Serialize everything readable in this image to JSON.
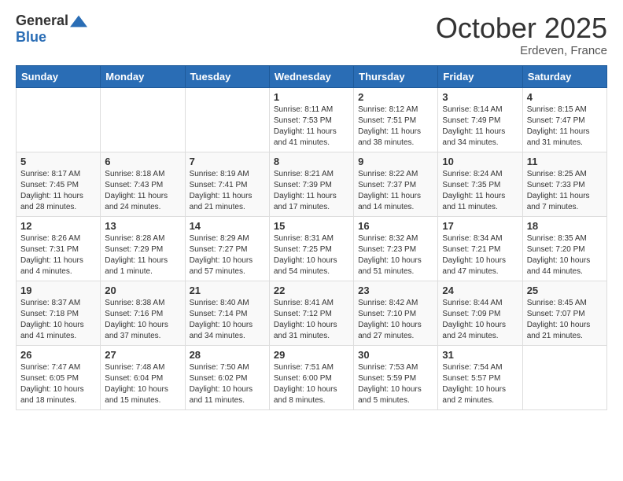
{
  "header": {
    "logo_general": "General",
    "logo_blue": "Blue",
    "month_title": "October 2025",
    "location": "Erdeven, France"
  },
  "weekdays": [
    "Sunday",
    "Monday",
    "Tuesday",
    "Wednesday",
    "Thursday",
    "Friday",
    "Saturday"
  ],
  "weeks": [
    [
      {
        "day": "",
        "sunrise": "",
        "sunset": "",
        "daylight": ""
      },
      {
        "day": "",
        "sunrise": "",
        "sunset": "",
        "daylight": ""
      },
      {
        "day": "",
        "sunrise": "",
        "sunset": "",
        "daylight": ""
      },
      {
        "day": "1",
        "sunrise": "Sunrise: 8:11 AM",
        "sunset": "Sunset: 7:53 PM",
        "daylight": "Daylight: 11 hours and 41 minutes."
      },
      {
        "day": "2",
        "sunrise": "Sunrise: 8:12 AM",
        "sunset": "Sunset: 7:51 PM",
        "daylight": "Daylight: 11 hours and 38 minutes."
      },
      {
        "day": "3",
        "sunrise": "Sunrise: 8:14 AM",
        "sunset": "Sunset: 7:49 PM",
        "daylight": "Daylight: 11 hours and 34 minutes."
      },
      {
        "day": "4",
        "sunrise": "Sunrise: 8:15 AM",
        "sunset": "Sunset: 7:47 PM",
        "daylight": "Daylight: 11 hours and 31 minutes."
      }
    ],
    [
      {
        "day": "5",
        "sunrise": "Sunrise: 8:17 AM",
        "sunset": "Sunset: 7:45 PM",
        "daylight": "Daylight: 11 hours and 28 minutes."
      },
      {
        "day": "6",
        "sunrise": "Sunrise: 8:18 AM",
        "sunset": "Sunset: 7:43 PM",
        "daylight": "Daylight: 11 hours and 24 minutes."
      },
      {
        "day": "7",
        "sunrise": "Sunrise: 8:19 AM",
        "sunset": "Sunset: 7:41 PM",
        "daylight": "Daylight: 11 hours and 21 minutes."
      },
      {
        "day": "8",
        "sunrise": "Sunrise: 8:21 AM",
        "sunset": "Sunset: 7:39 PM",
        "daylight": "Daylight: 11 hours and 17 minutes."
      },
      {
        "day": "9",
        "sunrise": "Sunrise: 8:22 AM",
        "sunset": "Sunset: 7:37 PM",
        "daylight": "Daylight: 11 hours and 14 minutes."
      },
      {
        "day": "10",
        "sunrise": "Sunrise: 8:24 AM",
        "sunset": "Sunset: 7:35 PM",
        "daylight": "Daylight: 11 hours and 11 minutes."
      },
      {
        "day": "11",
        "sunrise": "Sunrise: 8:25 AM",
        "sunset": "Sunset: 7:33 PM",
        "daylight": "Daylight: 11 hours and 7 minutes."
      }
    ],
    [
      {
        "day": "12",
        "sunrise": "Sunrise: 8:26 AM",
        "sunset": "Sunset: 7:31 PM",
        "daylight": "Daylight: 11 hours and 4 minutes."
      },
      {
        "day": "13",
        "sunrise": "Sunrise: 8:28 AM",
        "sunset": "Sunset: 7:29 PM",
        "daylight": "Daylight: 11 hours and 1 minute."
      },
      {
        "day": "14",
        "sunrise": "Sunrise: 8:29 AM",
        "sunset": "Sunset: 7:27 PM",
        "daylight": "Daylight: 10 hours and 57 minutes."
      },
      {
        "day": "15",
        "sunrise": "Sunrise: 8:31 AM",
        "sunset": "Sunset: 7:25 PM",
        "daylight": "Daylight: 10 hours and 54 minutes."
      },
      {
        "day": "16",
        "sunrise": "Sunrise: 8:32 AM",
        "sunset": "Sunset: 7:23 PM",
        "daylight": "Daylight: 10 hours and 51 minutes."
      },
      {
        "day": "17",
        "sunrise": "Sunrise: 8:34 AM",
        "sunset": "Sunset: 7:21 PM",
        "daylight": "Daylight: 10 hours and 47 minutes."
      },
      {
        "day": "18",
        "sunrise": "Sunrise: 8:35 AM",
        "sunset": "Sunset: 7:20 PM",
        "daylight": "Daylight: 10 hours and 44 minutes."
      }
    ],
    [
      {
        "day": "19",
        "sunrise": "Sunrise: 8:37 AM",
        "sunset": "Sunset: 7:18 PM",
        "daylight": "Daylight: 10 hours and 41 minutes."
      },
      {
        "day": "20",
        "sunrise": "Sunrise: 8:38 AM",
        "sunset": "Sunset: 7:16 PM",
        "daylight": "Daylight: 10 hours and 37 minutes."
      },
      {
        "day": "21",
        "sunrise": "Sunrise: 8:40 AM",
        "sunset": "Sunset: 7:14 PM",
        "daylight": "Daylight: 10 hours and 34 minutes."
      },
      {
        "day": "22",
        "sunrise": "Sunrise: 8:41 AM",
        "sunset": "Sunset: 7:12 PM",
        "daylight": "Daylight: 10 hours and 31 minutes."
      },
      {
        "day": "23",
        "sunrise": "Sunrise: 8:42 AM",
        "sunset": "Sunset: 7:10 PM",
        "daylight": "Daylight: 10 hours and 27 minutes."
      },
      {
        "day": "24",
        "sunrise": "Sunrise: 8:44 AM",
        "sunset": "Sunset: 7:09 PM",
        "daylight": "Daylight: 10 hours and 24 minutes."
      },
      {
        "day": "25",
        "sunrise": "Sunrise: 8:45 AM",
        "sunset": "Sunset: 7:07 PM",
        "daylight": "Daylight: 10 hours and 21 minutes."
      }
    ],
    [
      {
        "day": "26",
        "sunrise": "Sunrise: 7:47 AM",
        "sunset": "Sunset: 6:05 PM",
        "daylight": "Daylight: 10 hours and 18 minutes."
      },
      {
        "day": "27",
        "sunrise": "Sunrise: 7:48 AM",
        "sunset": "Sunset: 6:04 PM",
        "daylight": "Daylight: 10 hours and 15 minutes."
      },
      {
        "day": "28",
        "sunrise": "Sunrise: 7:50 AM",
        "sunset": "Sunset: 6:02 PM",
        "daylight": "Daylight: 10 hours and 11 minutes."
      },
      {
        "day": "29",
        "sunrise": "Sunrise: 7:51 AM",
        "sunset": "Sunset: 6:00 PM",
        "daylight": "Daylight: 10 hours and 8 minutes."
      },
      {
        "day": "30",
        "sunrise": "Sunrise: 7:53 AM",
        "sunset": "Sunset: 5:59 PM",
        "daylight": "Daylight: 10 hours and 5 minutes."
      },
      {
        "day": "31",
        "sunrise": "Sunrise: 7:54 AM",
        "sunset": "Sunset: 5:57 PM",
        "daylight": "Daylight: 10 hours and 2 minutes."
      },
      {
        "day": "",
        "sunrise": "",
        "sunset": "",
        "daylight": ""
      }
    ]
  ]
}
